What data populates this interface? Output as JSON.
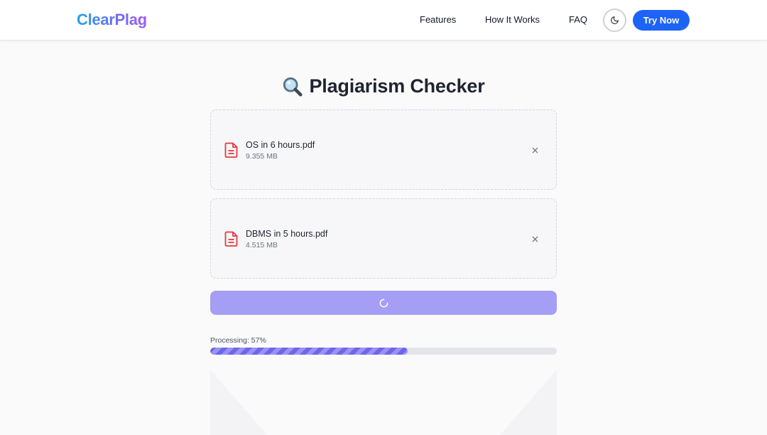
{
  "navbar": {
    "logo": "ClearPlag",
    "links": [
      "Features",
      "How It Works",
      "FAQ"
    ],
    "theme_toggle_icon": "moon-icon",
    "cta_label": "Try Now"
  },
  "main": {
    "title_icon": "magnifier-icon",
    "title": "Plagiarism Checker",
    "files": [
      {
        "name": "OS in 6 hours.pdf",
        "size": "9.355 MB",
        "icon": "pdf-file-icon"
      },
      {
        "name": "DBMS in 5 hours.pdf",
        "size": "4.515 MB",
        "icon": "pdf-file-icon"
      }
    ],
    "check_button_icon": "loading-spinner-icon",
    "progress": {
      "label": "Processing: 57%",
      "percent": 57
    }
  },
  "colors": {
    "accent": "#1d63f5",
    "button_disabled": "#a59ef5",
    "progress": "#6f66e9",
    "file_icon": "#e5383b"
  }
}
